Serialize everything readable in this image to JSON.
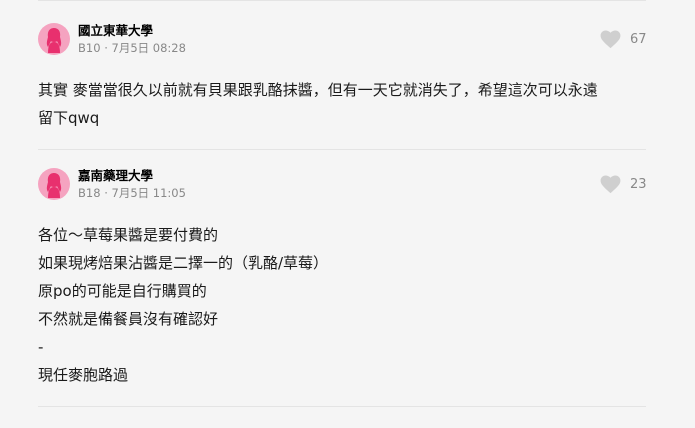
{
  "comments": [
    {
      "school": "國立東華大學",
      "floor": "B10",
      "date": "7月5日 08:28",
      "likes": "67",
      "lines": [
        "其實 麥當當很久以前就有貝果跟乳酪抹醬，但有一天它就消失了，希望這次可以永遠",
        "留下qwq"
      ]
    },
    {
      "school": "嘉南藥理大學",
      "floor": "B18",
      "date": "7月5日 11:05",
      "likes": "23",
      "lines": [
        "各位～草莓果醬是要付費的",
        "如果現烤焙果沾醬是二擇一的（乳酪/草莓）",
        "原po的可能是自行購買的",
        "不然就是備餐員沒有確認好",
        "-",
        "現任麥胞路過"
      ]
    }
  ],
  "colors": {
    "avatar_bg": "#f5a3c0",
    "avatar_figure": "#e8306e",
    "heart": "#cfcfcf",
    "meta_text": "#888888"
  },
  "icons": {
    "avatar": "female-avatar-icon",
    "like": "heart-icon"
  }
}
